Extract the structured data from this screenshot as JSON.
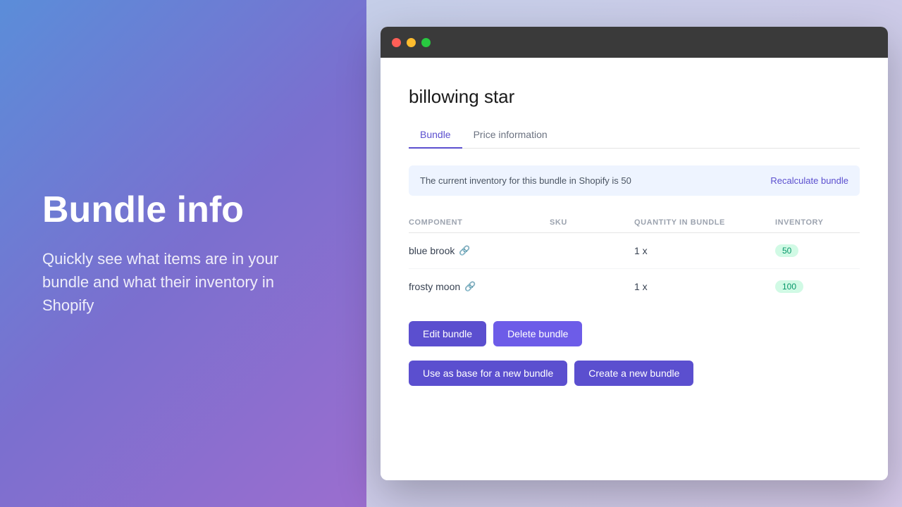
{
  "leftPanel": {
    "heading": "Bundle info",
    "description": "Quickly see what items are in your bundle and what their inventory in Shopify"
  },
  "browser": {
    "appTitle": "billowing star",
    "tabs": [
      {
        "id": "bundle",
        "label": "Bundle",
        "active": true
      },
      {
        "id": "price-info",
        "label": "Price information",
        "active": false
      }
    ],
    "infoBanner": {
      "text": "The current inventory for this bundle in Shopify is 50",
      "recalculateLabel": "Recalculate bundle"
    },
    "table": {
      "headers": {
        "component": "COMPONENT",
        "sku": "SKU",
        "quantityInBundle": "QUANTITY IN BUNDLE",
        "inventory": "INVENTORY"
      },
      "rows": [
        {
          "id": 1,
          "component": "blue brook",
          "sku": "",
          "quantityInBundle": "1 x",
          "inventory": "50",
          "badgeClass": "badge-green"
        },
        {
          "id": 2,
          "component": "frosty moon",
          "sku": "",
          "quantityInBundle": "1 x",
          "inventory": "100",
          "badgeClass": "badge-green"
        }
      ]
    },
    "buttons": {
      "editBundle": "Edit bundle",
      "deleteBundle": "Delete bundle",
      "useAsBase": "Use as base for a new bundle",
      "createNew": "Create a new bundle"
    }
  },
  "icons": {
    "linkIcon": "🔗",
    "trafficRed": "#ff5f57",
    "trafficYellow": "#febc2e",
    "trafficGreen": "#28c840"
  }
}
